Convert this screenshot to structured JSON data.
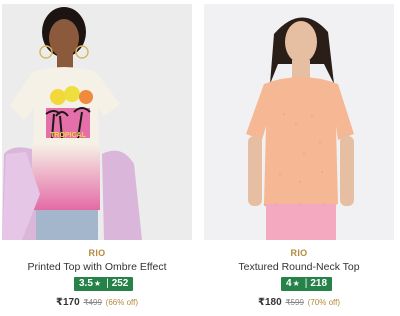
{
  "products": [
    {
      "brand": "RIO",
      "name": "Printed Top with Ombre Effect",
      "rating": "3.5",
      "rating_count": "252",
      "price": "₹170",
      "mrp": "₹499",
      "discount": "(66% off)",
      "print_text": "TROPICAL",
      "colors": {
        "top": "#f5f1e6",
        "ombre": "#e46aa6",
        "jacket": "#d9b6da",
        "jeans": "#a4b6cc",
        "skin": "#8b5a3c",
        "hair": "#1c1410"
      }
    },
    {
      "brand": "RIO",
      "name": "Textured Round-Neck Top",
      "rating": "4",
      "rating_count": "218",
      "price": "₹180",
      "mrp": "₹599",
      "discount": "(70% off)",
      "colors": {
        "top": "#f6b894",
        "skirt": "#f5a9c0",
        "skin": "#e6bfa2",
        "hair": "#2a1e18"
      }
    }
  ],
  "accent": {
    "brand_gold": "#b58a3c",
    "rating_green": "#27824a"
  }
}
